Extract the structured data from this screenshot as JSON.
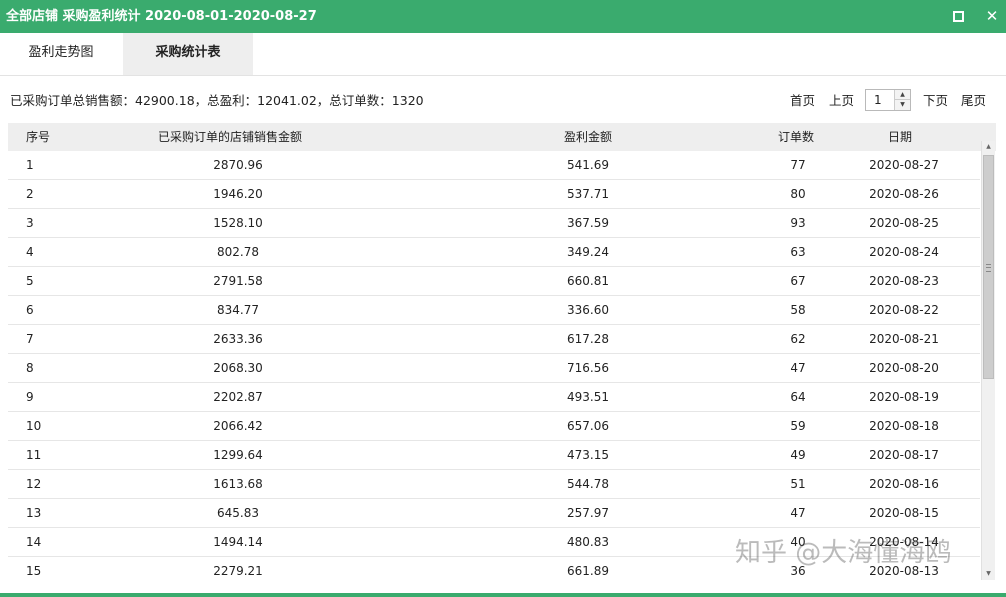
{
  "window": {
    "title": "全部店铺 采购盈利统计 2020-08-01-2020-08-27",
    "accent_color": "#3aab6e"
  },
  "tabs": [
    {
      "label": "盈利走势图",
      "active": false
    },
    {
      "label": "采购统计表",
      "active": true
    }
  ],
  "summary": "已采购订单总销售额：42900.18，总盈利：12041.02，总订单数：1320",
  "pager": {
    "first": "首页",
    "prev": "上页",
    "page": "1",
    "next": "下页",
    "last": "尾页"
  },
  "table": {
    "headers": {
      "idx": "序号",
      "amount": "已采购订单的店铺销售金额",
      "profit": "盈利金额",
      "orders": "订单数",
      "date": "日期"
    },
    "rows": [
      {
        "idx": "1",
        "amount": "2870.96",
        "profit": "541.69",
        "orders": "77",
        "date": "2020-08-27"
      },
      {
        "idx": "2",
        "amount": "1946.20",
        "profit": "537.71",
        "orders": "80",
        "date": "2020-08-26"
      },
      {
        "idx": "3",
        "amount": "1528.10",
        "profit": "367.59",
        "orders": "93",
        "date": "2020-08-25"
      },
      {
        "idx": "4",
        "amount": "802.78",
        "profit": "349.24",
        "orders": "63",
        "date": "2020-08-24"
      },
      {
        "idx": "5",
        "amount": "2791.58",
        "profit": "660.81",
        "orders": "67",
        "date": "2020-08-23"
      },
      {
        "idx": "6",
        "amount": "834.77",
        "profit": "336.60",
        "orders": "58",
        "date": "2020-08-22"
      },
      {
        "idx": "7",
        "amount": "2633.36",
        "profit": "617.28",
        "orders": "62",
        "date": "2020-08-21"
      },
      {
        "idx": "8",
        "amount": "2068.30",
        "profit": "716.56",
        "orders": "47",
        "date": "2020-08-20"
      },
      {
        "idx": "9",
        "amount": "2202.87",
        "profit": "493.51",
        "orders": "64",
        "date": "2020-08-19"
      },
      {
        "idx": "10",
        "amount": "2066.42",
        "profit": "657.06",
        "orders": "59",
        "date": "2020-08-18"
      },
      {
        "idx": "11",
        "amount": "1299.64",
        "profit": "473.15",
        "orders": "49",
        "date": "2020-08-17"
      },
      {
        "idx": "12",
        "amount": "1613.68",
        "profit": "544.78",
        "orders": "51",
        "date": "2020-08-16"
      },
      {
        "idx": "13",
        "amount": "645.83",
        "profit": "257.97",
        "orders": "47",
        "date": "2020-08-15"
      },
      {
        "idx": "14",
        "amount": "1494.14",
        "profit": "480.83",
        "orders": "40",
        "date": "2020-08-14"
      },
      {
        "idx": "15",
        "amount": "2279.21",
        "profit": "661.89",
        "orders": "36",
        "date": "2020-08-13"
      }
    ]
  },
  "watermark": "知乎 @大海懂海鸥",
  "icons": {
    "maximize": "maximize-icon",
    "close": "close-icon",
    "spin_up": "chevron-up-icon",
    "spin_down": "chevron-down-icon"
  }
}
